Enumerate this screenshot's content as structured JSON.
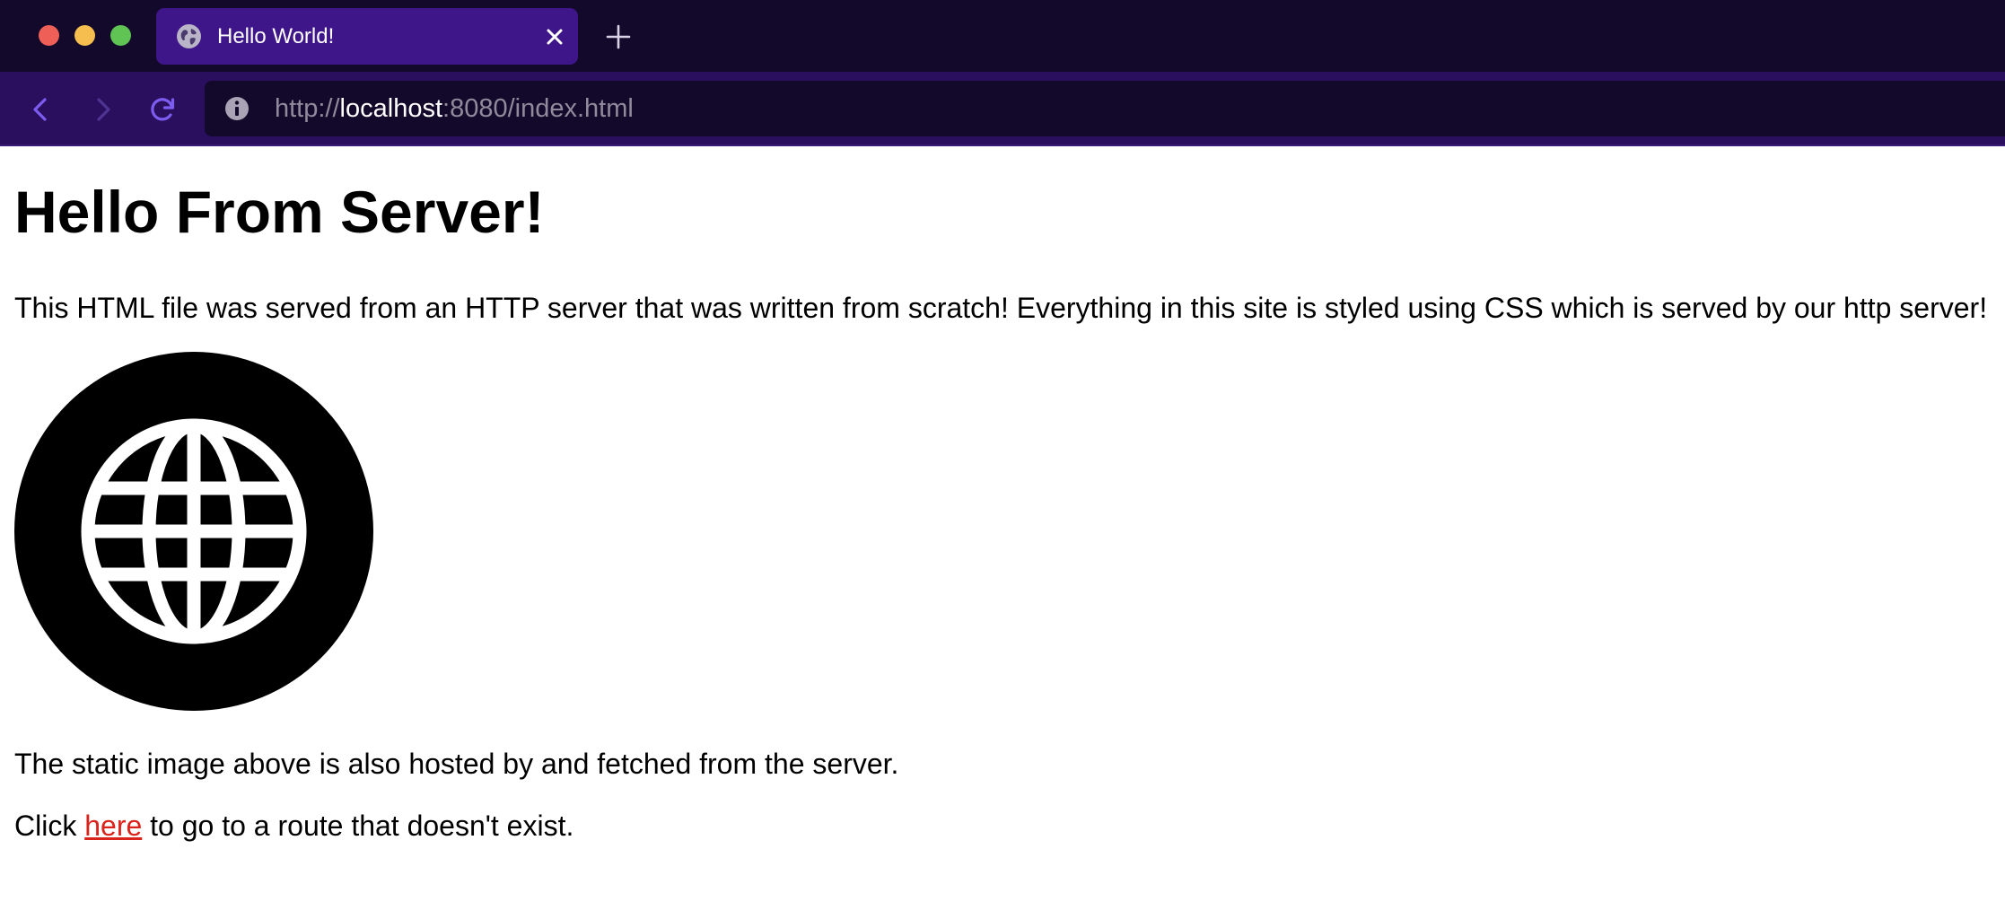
{
  "window": {
    "traffic_lights": {
      "close": "#ee5f57",
      "minimize": "#f5be4f",
      "maximize": "#5fc454"
    }
  },
  "tab": {
    "title": "Hello World!",
    "favicon": "globe-icon",
    "close_icon": "close-icon"
  },
  "new_tab_icon": "plus-icon",
  "navigation": {
    "back_icon": "chevron-left-icon",
    "forward_icon": "chevron-right-icon",
    "reload_icon": "reload-icon"
  },
  "address_bar": {
    "info_icon": "info-icon",
    "scheme": "http://",
    "host": "localhost",
    "rest": ":8080/index.html"
  },
  "page": {
    "heading": "Hello From Server!",
    "intro": "This HTML file was served from an HTTP server that was written from scratch! Everything in this site is styled using CSS which is served by our http server!",
    "image_icon": "globe-icon",
    "static_note": "The static image above is also hosted by and fetched from the server.",
    "click_prefix": "Click ",
    "link_text": "here",
    "click_suffix": " to go to a route that doesn't exist."
  },
  "colors": {
    "tab_strip": "#13092a",
    "active_tab": "#3f168a",
    "toolbar": "#2a0f5e",
    "nav_icons": "#7c5df0",
    "link": "#d9231b"
  }
}
